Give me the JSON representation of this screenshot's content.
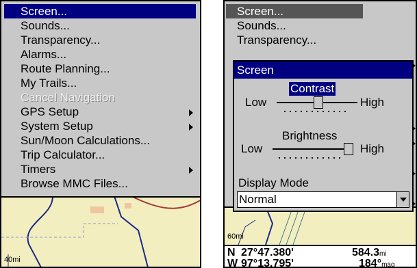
{
  "left_menu": {
    "items": [
      {
        "label": "Screen...",
        "selected": true
      },
      {
        "label": "Sounds..."
      },
      {
        "label": "Transparency..."
      },
      {
        "label": "Alarms..."
      },
      {
        "label": "Route Planning..."
      },
      {
        "label": "My Trails..."
      },
      {
        "label": "Cancel Navigation",
        "disabled": true
      },
      {
        "label": "GPS Setup",
        "submenu": true
      },
      {
        "label": "System Setup",
        "submenu": true
      },
      {
        "label": "Sun/Moon Calculations..."
      },
      {
        "label": "Trip Calculator..."
      },
      {
        "label": "Timers",
        "submenu": true
      },
      {
        "label": "Browse MMC Files..."
      }
    ],
    "scale_label": "40mi"
  },
  "right_menu": {
    "items": [
      "Screen...",
      "Sounds...",
      "Transparency..."
    ],
    "scale_label": "60mi"
  },
  "screen_dialog": {
    "title": "Screen",
    "contrast": {
      "label": "Contrast",
      "low": "Low",
      "high": "High",
      "level": 0.5
    },
    "brightness": {
      "label": "Brightness",
      "low": "Low",
      "high": "High",
      "level": 1.0
    },
    "display_mode_label": "Display Mode",
    "display_mode_value": "Normal"
  },
  "status": {
    "lat_hemi": "N",
    "lat": "27°47.380'",
    "lon_hemi": "W",
    "lon": "97°13.795'",
    "distance": "584.3",
    "distance_unit": "mi",
    "bearing": "184°",
    "bearing_unit": "mag"
  },
  "colors": {
    "highlight": "#000080",
    "menu_bg": "#c8c8c8",
    "map_bg": "#f3eebf"
  }
}
